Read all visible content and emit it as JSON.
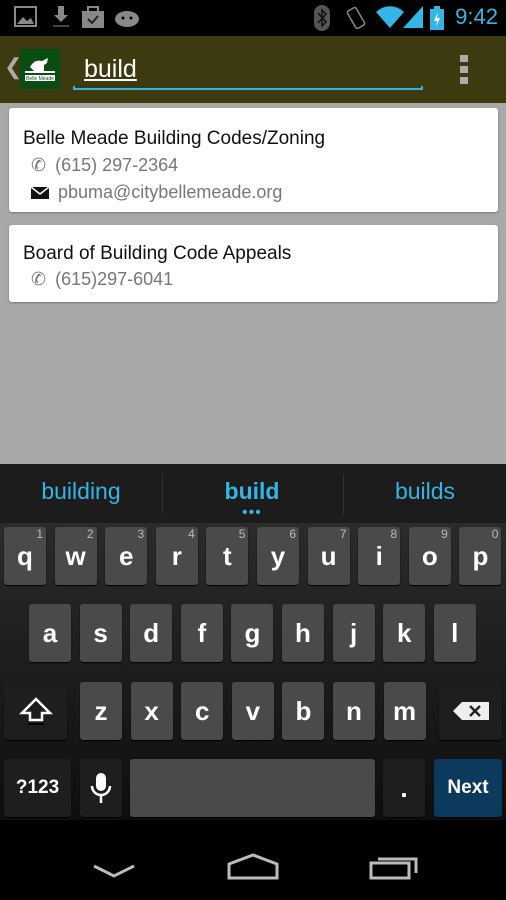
{
  "status": {
    "clock": "9:42",
    "icons": [
      "picture-icon",
      "download-icon",
      "bag-check-icon",
      "android-icon",
      "bluetooth-icon",
      "vibrate-icon",
      "wifi-icon",
      "signal-icon",
      "battery-charging-icon"
    ]
  },
  "toolbar": {
    "logo_text": "Belle Meade",
    "query": "build",
    "menu_icon": "overflow-menu-icon"
  },
  "results": [
    {
      "title": "Belle Meade Building Codes/Zoning",
      "phone": "(615) 297-2364",
      "email": "pbuma@citybellemeade.org"
    },
    {
      "title": "Board of Building Code Appeals",
      "phone": "(615)297-6041"
    }
  ],
  "suggestions": [
    "building",
    "build",
    "builds"
  ],
  "keyboard": {
    "row1": [
      "q",
      "w",
      "e",
      "r",
      "t",
      "y",
      "u",
      "i",
      "o",
      "p"
    ],
    "hints": [
      "1",
      "2",
      "3",
      "4",
      "5",
      "6",
      "7",
      "8",
      "9",
      "0"
    ],
    "row2": [
      "a",
      "s",
      "d",
      "f",
      "g",
      "h",
      "j",
      "k",
      "l"
    ],
    "row3": [
      "z",
      "x",
      "c",
      "v",
      "b",
      "n",
      "m"
    ],
    "symbols": "?123",
    "period": ".",
    "action": "Next"
  },
  "colors": {
    "accent": "#33b5e5",
    "toolbar": "#3d3a0f",
    "next_key": "#0b3a5c"
  }
}
